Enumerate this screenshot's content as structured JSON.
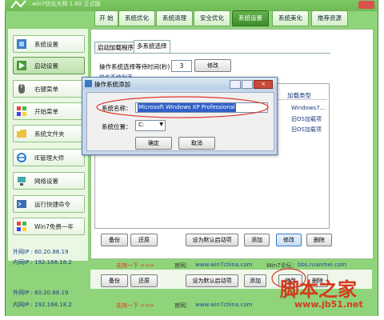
{
  "window": {
    "title": "win7优化大师 1.60 正式版",
    "controls": [
      "_",
      "□",
      "×"
    ]
  },
  "tabs": [
    "开 始",
    "系统优化",
    "系统清理",
    "安全优化",
    "系统设置",
    "系统美化",
    "推荐资源"
  ],
  "active_tab": "系统设置",
  "sidebar": {
    "items": [
      "系统设置",
      "启动设置",
      "右键菜单",
      "开始菜单",
      "系统文件夹",
      "IE管理大师",
      "网络设置",
      "运行快捷命令",
      "Win7免费一年"
    ],
    "active": "启动设置",
    "ip_outer": "外网IP : 60.20.88.19",
    "ip_inner": "内网IP : 192.168.18.2"
  },
  "subtabs": [
    "启动加载程序",
    "多系统选择"
  ],
  "wait_label": "操作系统选择等待时间(秒)：",
  "wait_value": "3",
  "modify_label": "修改",
  "grid_header_clip": "操作系统列表",
  "load_type_header": "加载类型",
  "rows": [
    "Windows7...",
    "旧OS加载项",
    "旧OS加载项"
  ],
  "dialog": {
    "title": "操作系统添加",
    "name_label": "系统名称：",
    "name_value": "Microsoft Windows XP Professional",
    "pos_label": "系统位置：",
    "pos_value": "C:",
    "ok": "确定",
    "cancel": "取消"
  },
  "buttons": {
    "backup": "备份",
    "restore": "还原",
    "set_default": "设为默认启动项",
    "add": "添加",
    "modify": "修改",
    "delete": "删除"
  },
  "footer": {
    "support": "支持一下 >>>",
    "site_label": "官网：",
    "site_url": "www.win7china.com",
    "forum_label": "Win7论坛：",
    "forum_url": "bbs.ruanmei.com"
  },
  "watermark": {
    "cn": "脚本之家",
    "url": "www.jb51.net"
  },
  "colors": {
    "frame": "#8fd37a",
    "active_tab": "#3f8d2c",
    "link": "#1c4a9a",
    "support": "#e03a1a",
    "ellipse": "#d9372b"
  }
}
